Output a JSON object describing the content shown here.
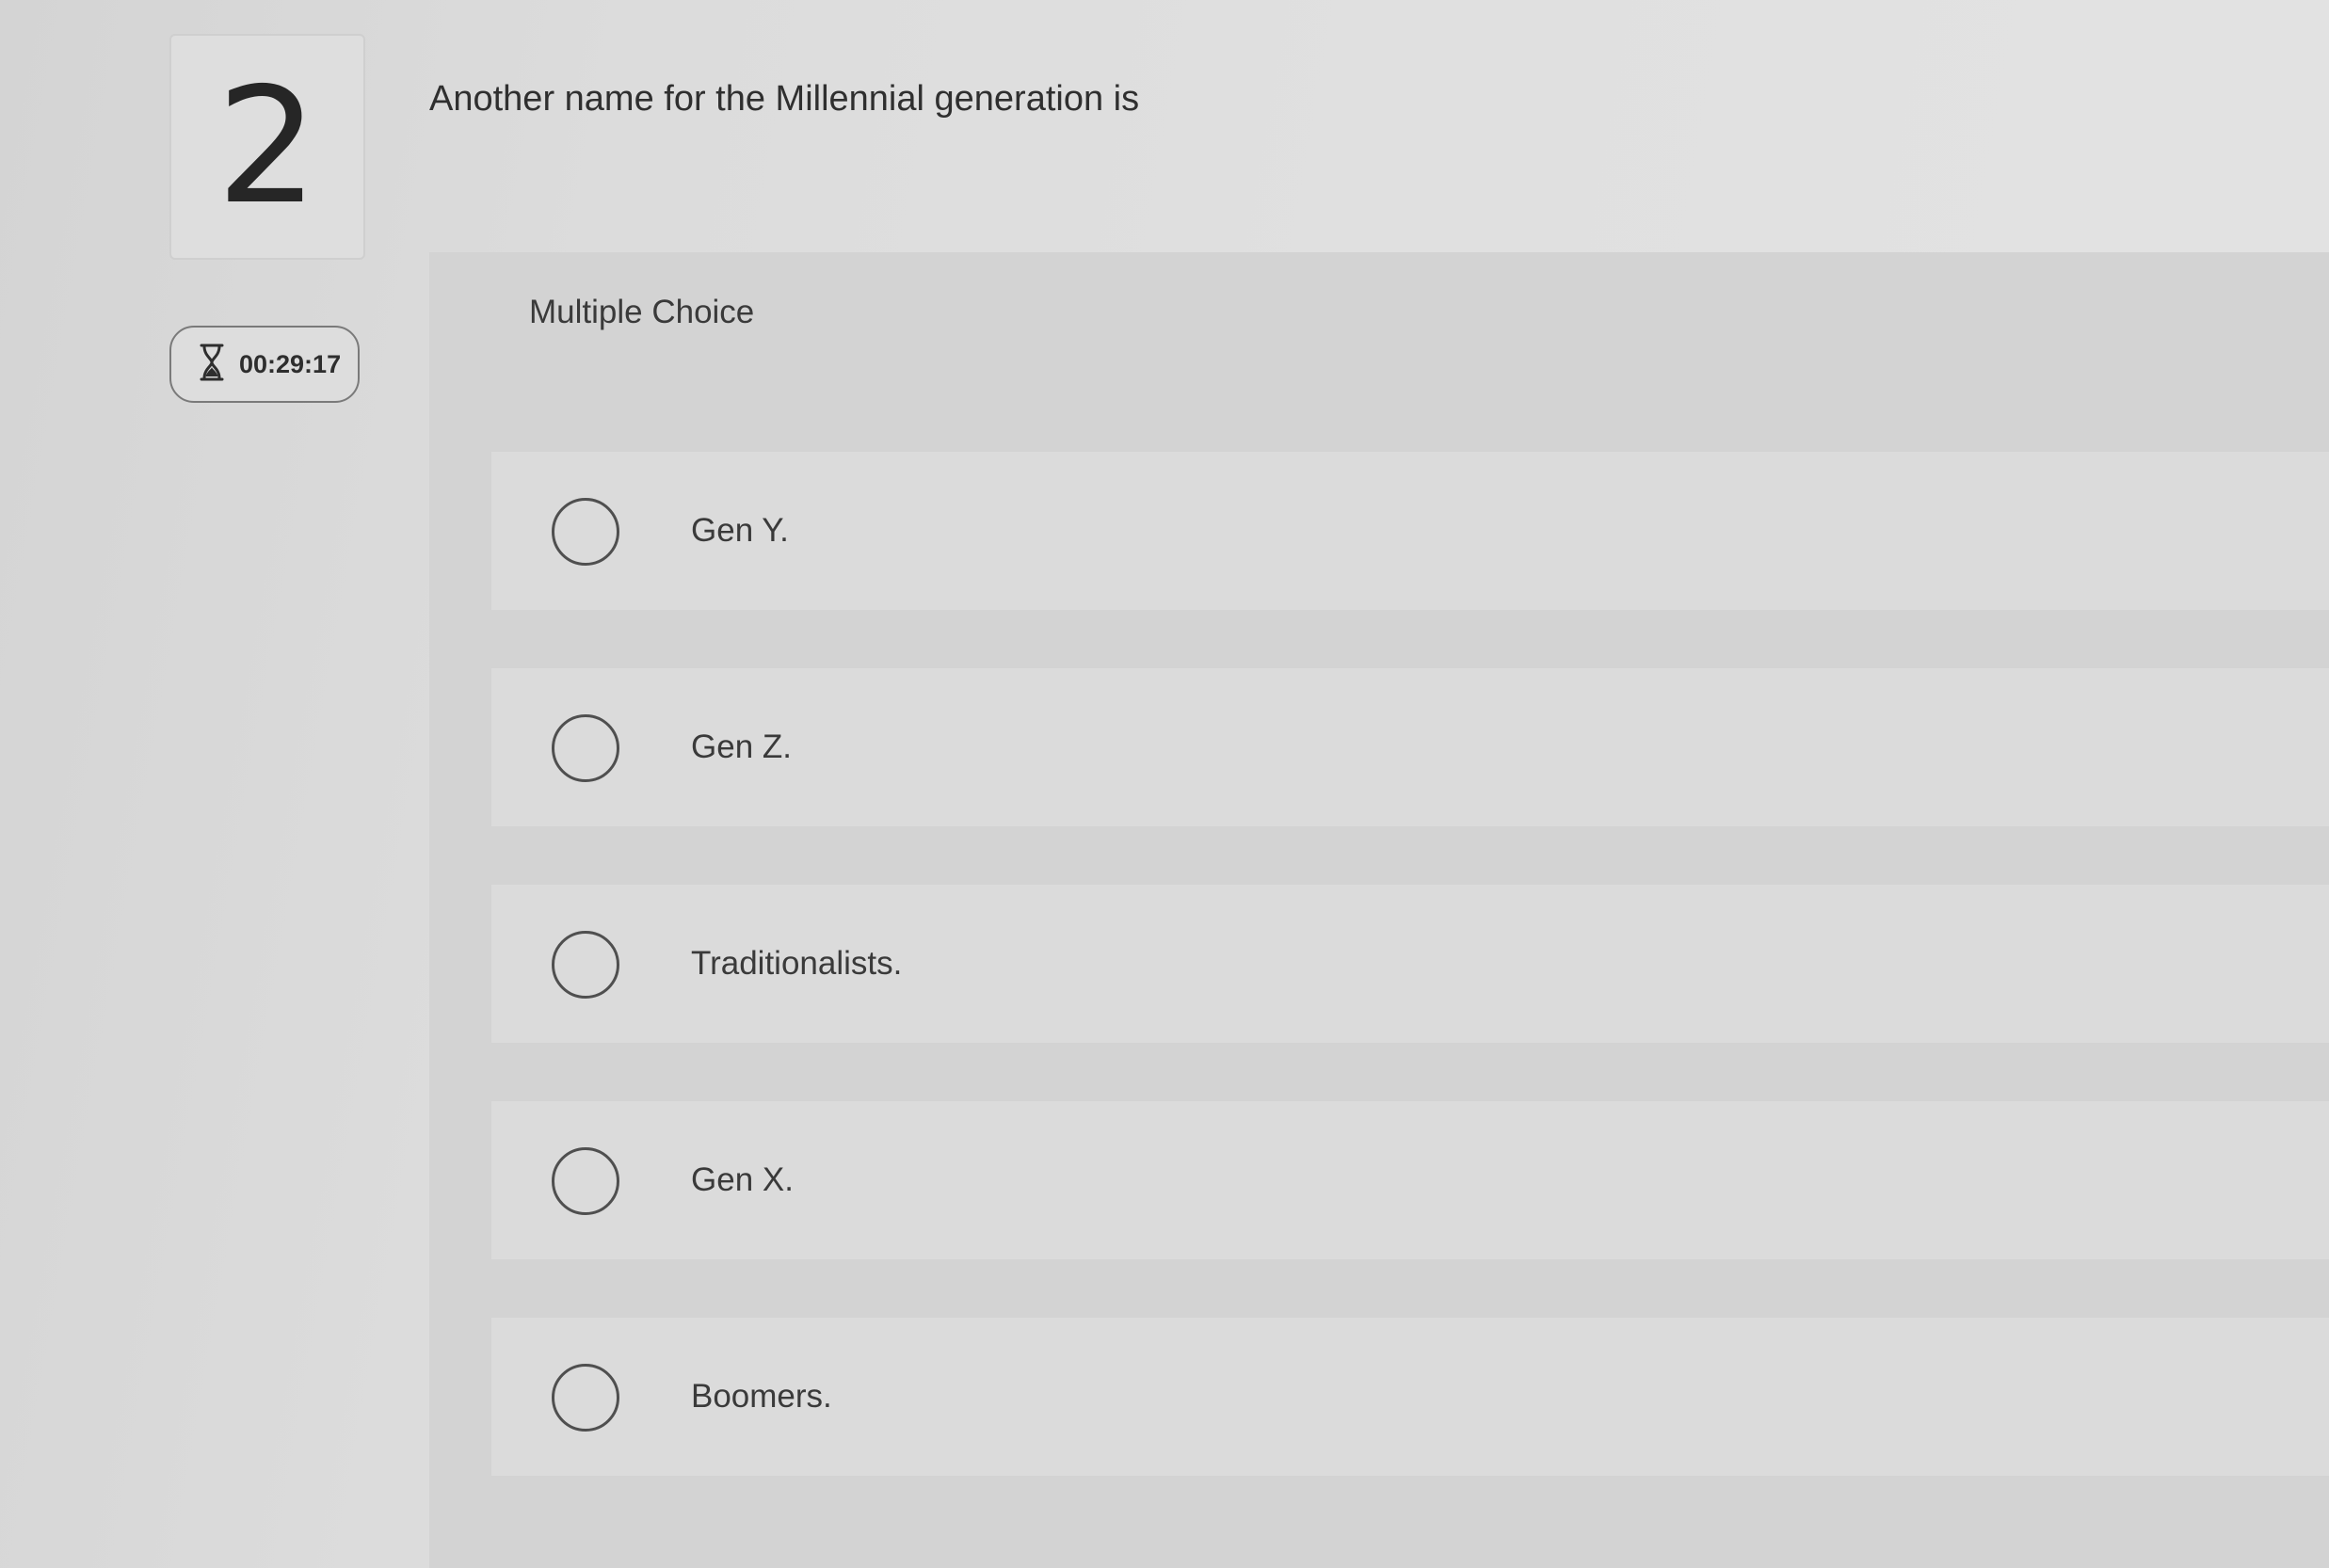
{
  "question": {
    "number": "2",
    "text": "Another name for the Millennial generation is"
  },
  "timer": {
    "icon": "hourglass-icon",
    "value": "00:29:17"
  },
  "answer_panel": {
    "type_label": "Multiple Choice",
    "options": [
      {
        "label": "Gen Y."
      },
      {
        "label": "Gen Z."
      },
      {
        "label": "Traditionalists."
      },
      {
        "label": "Gen X."
      },
      {
        "label": "Boomers."
      }
    ]
  },
  "colors": {
    "text": "#2f2f2f",
    "radio_border": "#4f4f4f",
    "panel_bg": "#d3d3d3",
    "option_bg": "#dbdbdb"
  }
}
